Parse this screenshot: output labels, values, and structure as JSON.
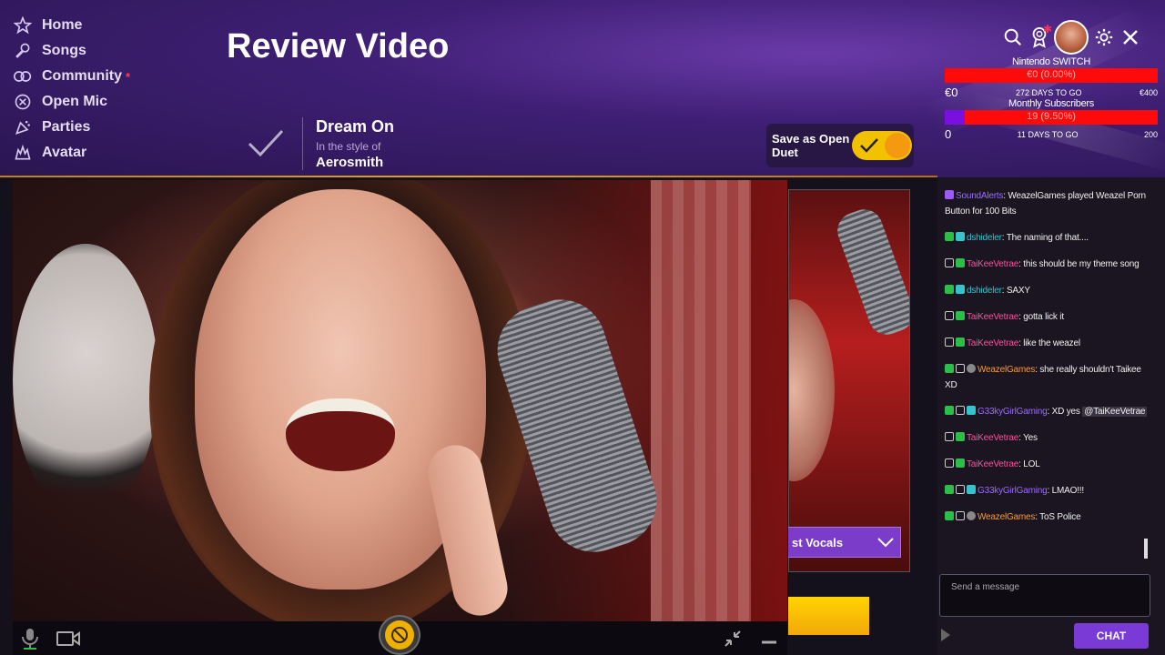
{
  "nav": {
    "items": [
      {
        "label": "Home",
        "icon": "star-icon"
      },
      {
        "label": "Songs",
        "icon": "microphone-icon"
      },
      {
        "label": "Community",
        "icon": "community-icon",
        "badge": "*"
      },
      {
        "label": "Open Mic",
        "icon": "open-mic-icon"
      },
      {
        "label": "Parties",
        "icon": "parties-icon"
      },
      {
        "label": "Avatar",
        "icon": "avatar-icon"
      }
    ]
  },
  "page": {
    "title": "Review Video"
  },
  "song": {
    "title": "Dream On",
    "style_prefix": "In the style of",
    "artist": "Aerosmith"
  },
  "open_duet": {
    "label": "Save as Open Duet",
    "enabled": true
  },
  "goals": [
    {
      "name": "Nintendo SWITCH",
      "bar_text": "€0 (0.00%)",
      "progress": 0.0,
      "left": "€0",
      "middle": "272 DAYS TO GO",
      "right": "€400"
    },
    {
      "name": "Monthly Subscribers",
      "bar_text": "19 (9.50%)",
      "progress": 0.095,
      "left": "0",
      "middle": "11 DAYS TO GO",
      "right": "200"
    }
  ],
  "vocals": {
    "label": "st Vocals"
  },
  "chat": {
    "messages": [
      {
        "user": "SoundAlerts",
        "color": "#9b6bff",
        "badges": [
          "purple"
        ],
        "text": ": WeazelGames played Weazel Porn Button for 100 Bits"
      },
      {
        "user": "dshideler",
        "color": "#35c4cc",
        "badges": [
          "green",
          "cyan"
        ],
        "text": ": The naming of that...."
      },
      {
        "user": "TaiKeeVetrae",
        "color": "#ff4fa0",
        "badges": [
          "white",
          "green"
        ],
        "text": ": this should be my theme song"
      },
      {
        "user": "dshideler",
        "color": "#35c4cc",
        "badges": [
          "green",
          "cyan"
        ],
        "text": ": SAXY"
      },
      {
        "user": "TaiKeeVetrae",
        "color": "#ff4fa0",
        "badges": [
          "white",
          "green"
        ],
        "text": ": gotta lick it"
      },
      {
        "user": "TaiKeeVetrae",
        "color": "#ff4fa0",
        "badges": [
          "white",
          "green"
        ],
        "text": ": like the weazel"
      },
      {
        "user": "WeazelGames",
        "color": "#ff9a2e",
        "badges": [
          "green",
          "white",
          "grey"
        ],
        "text": ": she really shouldn't Taikee XD"
      },
      {
        "user": "G33kyGirlGaming",
        "color": "#9b6bff",
        "badges": [
          "green",
          "white",
          "cyan"
        ],
        "text": ": XD yes ",
        "mention": "@TaiKeeVetrae"
      },
      {
        "user": "TaiKeeVetrae",
        "color": "#ff4fa0",
        "badges": [
          "white",
          "green"
        ],
        "text": ": Yes"
      },
      {
        "user": "TaiKeeVetrae",
        "color": "#ff4fa0",
        "badges": [
          "white",
          "green"
        ],
        "text": ": LOL"
      },
      {
        "user": "G33kyGirlGaming",
        "color": "#9b6bff",
        "badges": [
          "green",
          "white",
          "cyan"
        ],
        "text": ": LMAO!!!"
      },
      {
        "user": "WeazelGames",
        "color": "#ff9a2e",
        "badges": [
          "green",
          "white",
          "grey"
        ],
        "text": ": ToS Police"
      }
    ],
    "input_placeholder": "Send a message",
    "send_label": "CHAT"
  },
  "colors": {
    "accent_purple": "#7a3ad6",
    "toggle_yellow": "#f2c200",
    "goal_red": "#ff0a0a"
  }
}
